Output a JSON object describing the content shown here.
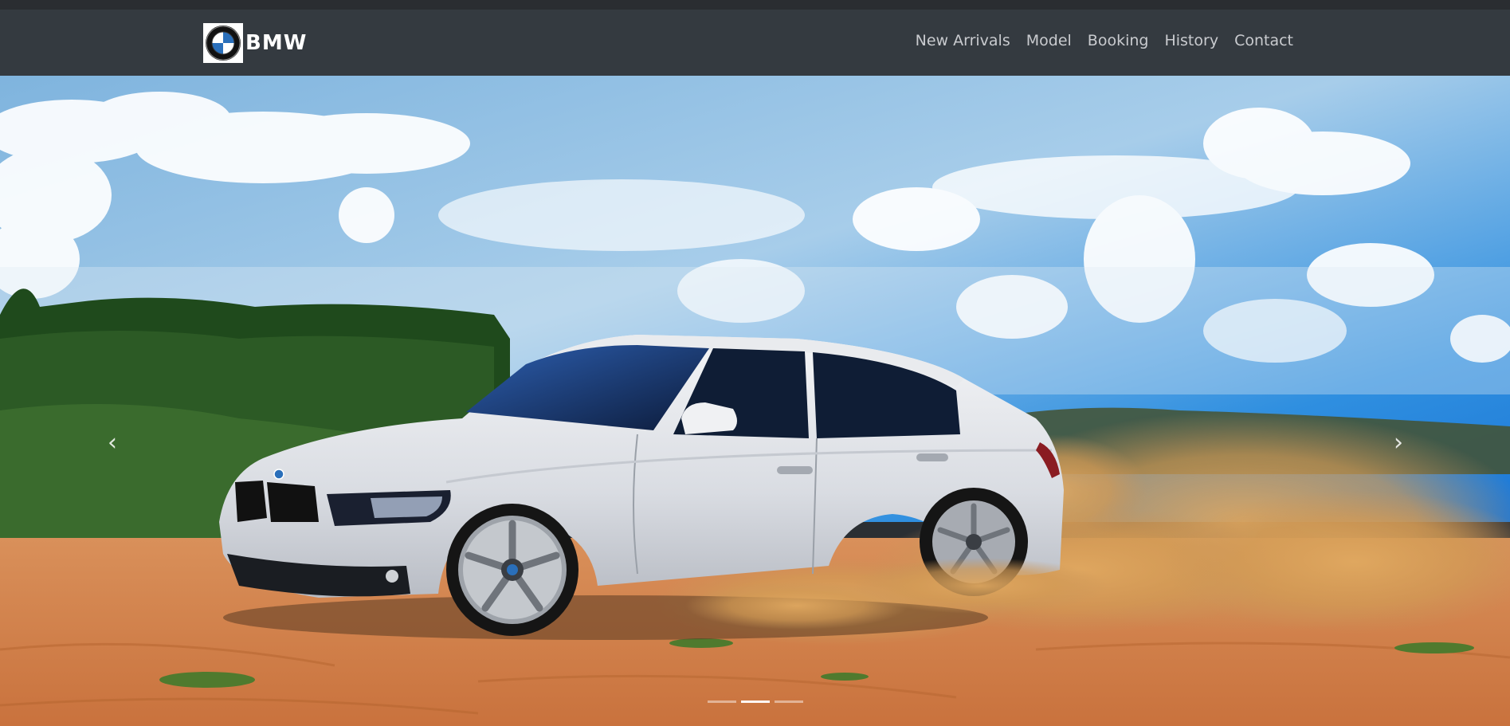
{
  "brand": {
    "logo": "bmw-roundel-logo",
    "name": "BMW"
  },
  "nav": {
    "links": [
      {
        "label": "New Arrivals"
      },
      {
        "label": "Model"
      },
      {
        "label": "Booking"
      },
      {
        "label": "History"
      },
      {
        "label": "Contact"
      }
    ]
  },
  "carousel": {
    "slide_image": "white BMW sedan drifting on dirt road with dust cloud",
    "prev_icon": "chevron-left-icon",
    "next_icon": "chevron-right-icon",
    "indicator_count": 3,
    "active_indicator": 1
  },
  "colors": {
    "navbar_bg": "#343a40",
    "nav_text": "#c9cbcf",
    "brand_text": "#ffffff"
  }
}
